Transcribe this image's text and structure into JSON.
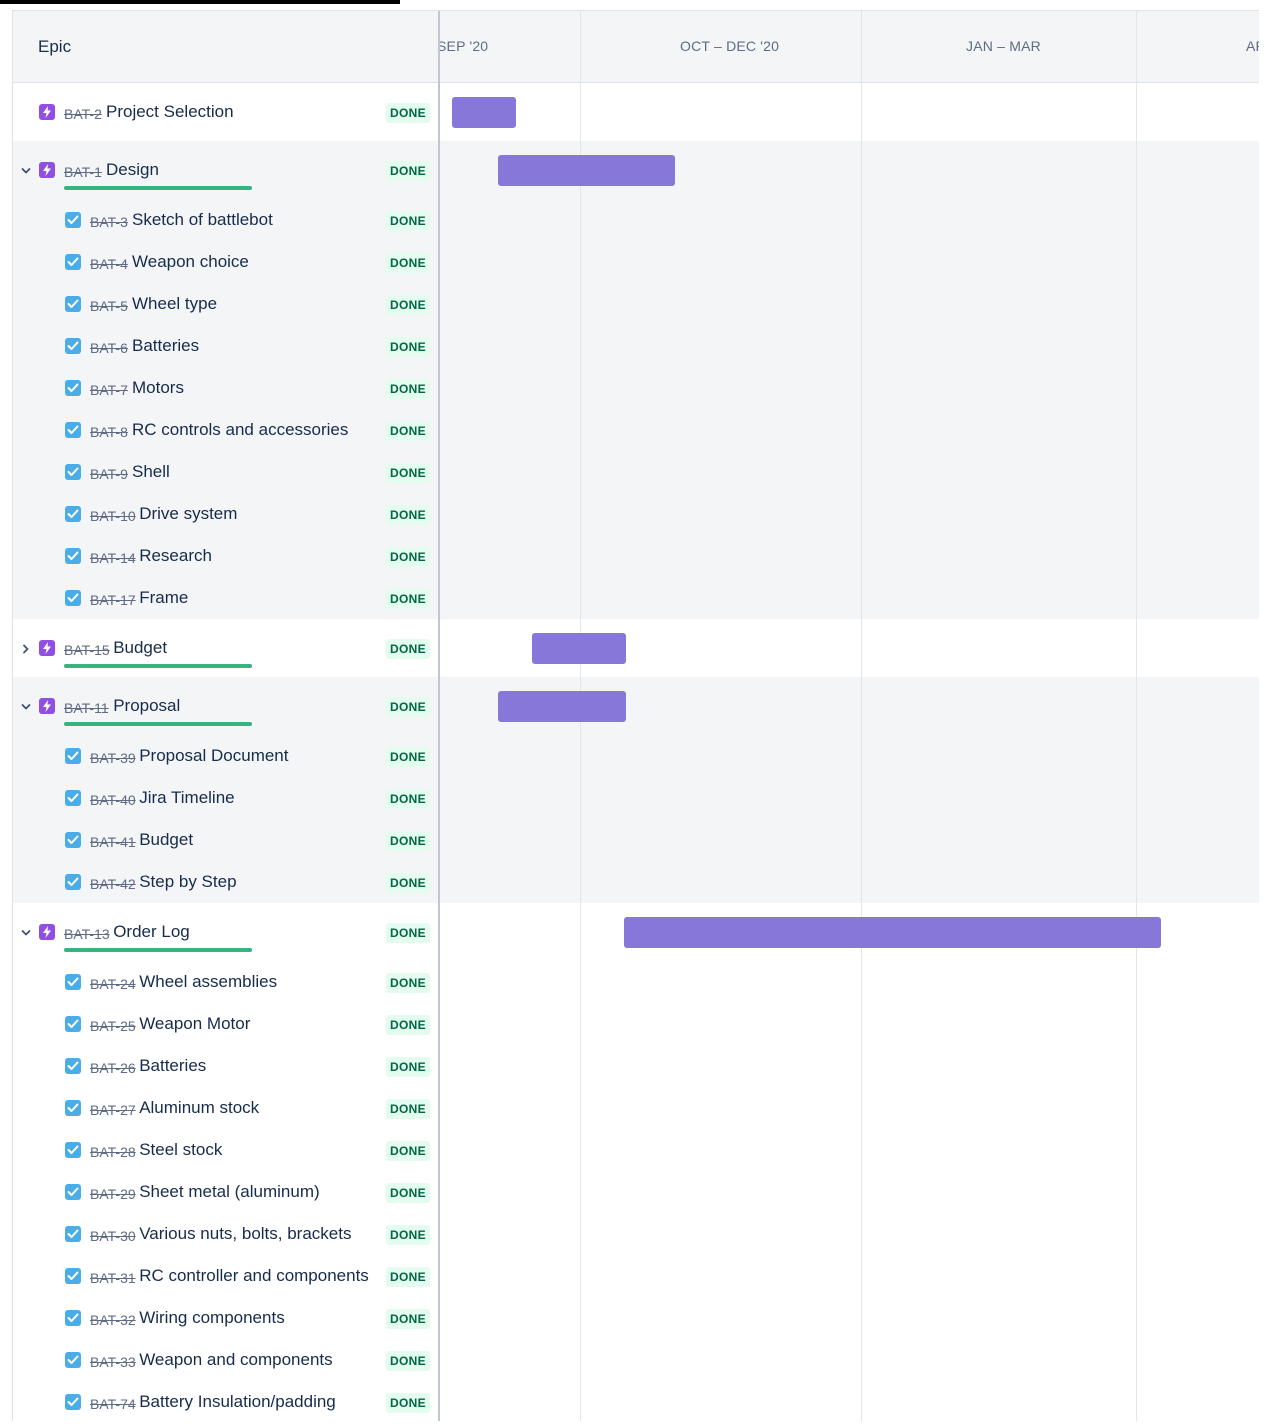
{
  "header": {
    "epic_title": "Epic"
  },
  "timeline": {
    "months": [
      "SEP '20",
      "OCT – DEC '20",
      "JAN – MAR",
      "AP"
    ]
  },
  "colors": {
    "bar": "#8777d9",
    "done_text": "#006644",
    "done_bg": "#e3fcef",
    "progress": "#36b37e",
    "epic_icon": "#904ee2",
    "task_icon": "#4bade8"
  },
  "epics": [
    {
      "key": "BAT-2",
      "summary": "Project Selection",
      "status": "DONE",
      "expanded": null,
      "children": []
    },
    {
      "key": "BAT-1",
      "summary": "Design",
      "status": "DONE",
      "expanded": true,
      "progress": 1.0,
      "children": [
        {
          "key": "BAT-3",
          "summary": "Sketch of battlebot",
          "status": "DONE"
        },
        {
          "key": "BAT-4",
          "summary": "Weapon choice",
          "status": "DONE"
        },
        {
          "key": "BAT-5",
          "summary": "Wheel type",
          "status": "DONE"
        },
        {
          "key": "BAT-6",
          "summary": "Batteries",
          "status": "DONE"
        },
        {
          "key": "BAT-7",
          "summary": "Motors",
          "status": "DONE"
        },
        {
          "key": "BAT-8",
          "summary": "RC controls and accessories",
          "status": "DONE"
        },
        {
          "key": "BAT-9",
          "summary": "Shell",
          "status": "DONE"
        },
        {
          "key": "BAT-10",
          "summary": "Drive system",
          "status": "DONE"
        },
        {
          "key": "BAT-14",
          "summary": "Research",
          "status": "DONE"
        },
        {
          "key": "BAT-17",
          "summary": "Frame",
          "status": "DONE"
        }
      ]
    },
    {
      "key": "BAT-15",
      "summary": "Budget",
      "status": "DONE",
      "expanded": false,
      "progress": 1.0,
      "children": []
    },
    {
      "key": "BAT-11",
      "summary": "Proposal",
      "status": "DONE",
      "expanded": true,
      "progress": 1.0,
      "children": [
        {
          "key": "BAT-39",
          "summary": "Proposal Document",
          "status": "DONE"
        },
        {
          "key": "BAT-40",
          "summary": "Jira Timeline",
          "status": "DONE"
        },
        {
          "key": "BAT-41",
          "summary": "Budget",
          "status": "DONE"
        },
        {
          "key": "BAT-42",
          "summary": "Step by Step",
          "status": "DONE"
        }
      ]
    },
    {
      "key": "BAT-13",
      "summary": "Order Log",
      "status": "DONE",
      "expanded": true,
      "progress": 1.0,
      "children": [
        {
          "key": "BAT-24",
          "summary": "Wheel assemblies",
          "status": "DONE"
        },
        {
          "key": "BAT-25",
          "summary": "Weapon Motor",
          "status": "DONE"
        },
        {
          "key": "BAT-26",
          "summary": "Batteries",
          "status": "DONE"
        },
        {
          "key": "BAT-27",
          "summary": "Aluminum stock",
          "status": "DONE"
        },
        {
          "key": "BAT-28",
          "summary": "Steel stock",
          "status": "DONE"
        },
        {
          "key": "BAT-29",
          "summary": "Sheet metal (aluminum)",
          "status": "DONE"
        },
        {
          "key": "BAT-30",
          "summary": "Various nuts, bolts, brackets",
          "status": "DONE"
        },
        {
          "key": "BAT-31",
          "summary": "RC controller and components",
          "status": "DONE"
        },
        {
          "key": "BAT-32",
          "summary": "Wiring components",
          "status": "DONE"
        },
        {
          "key": "BAT-33",
          "summary": "Weapon and components",
          "status": "DONE"
        },
        {
          "key": "BAT-74",
          "summary": "Battery Insulation/padding",
          "status": "DONE"
        }
      ]
    }
  ]
}
